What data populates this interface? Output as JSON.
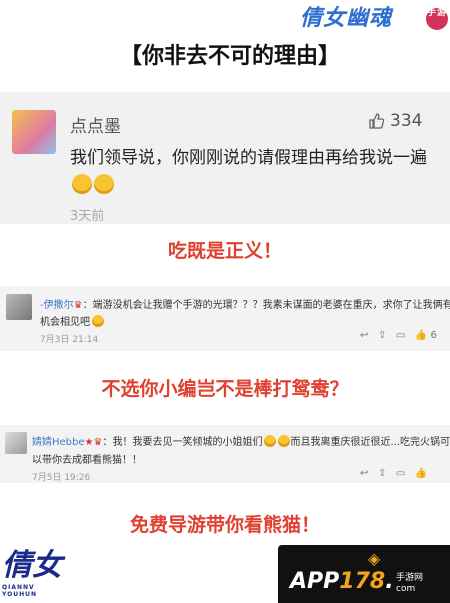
{
  "header": {
    "title": "【你非去不可的理由】",
    "top_logo_text": "倩女幽魂",
    "top_logo_badge": "手游"
  },
  "comment1": {
    "username": "点点墨",
    "likes": "334",
    "text": "我们领导说，你刚刚说的请假理由再给我说一遍",
    "time": "3天前"
  },
  "slogan1": "吃既是正义！",
  "comment2": {
    "username": "-伊撒尔",
    "text_line1": "：端游没机会让我赠个手游的光環？？？我素未谋面的老婆在重庆，求你了让我俩有个",
    "text_line2": "机会相见吧",
    "time": "7月3日 21:14",
    "likes": "6"
  },
  "slogan2": "不选你小编岂不是棒打鸳鸯？",
  "comment3": {
    "username": "婧婧Hebbe",
    "text_line1": "：我！我要去见一笑倾城的小姐姐们",
    "text_line1b": "而且我离重庆很近很近...吃完火锅可",
    "text_line2": "以带你去成都看熊猫！！",
    "time": "7月5日 19:26"
  },
  "slogan3": "免费导游带你看熊猫！",
  "bottom_left_logo": {
    "main": "倩女",
    "sub": "QIANNV YOUHUN"
  },
  "app_logo": {
    "prefix": "APP",
    "number": "178",
    "suffix": ".",
    "sub_line1": "手游网",
    "sub_line2": "com"
  },
  "icons": [
    "thumbs-up-icon",
    "reply-icon",
    "share-icon",
    "like-icon"
  ]
}
